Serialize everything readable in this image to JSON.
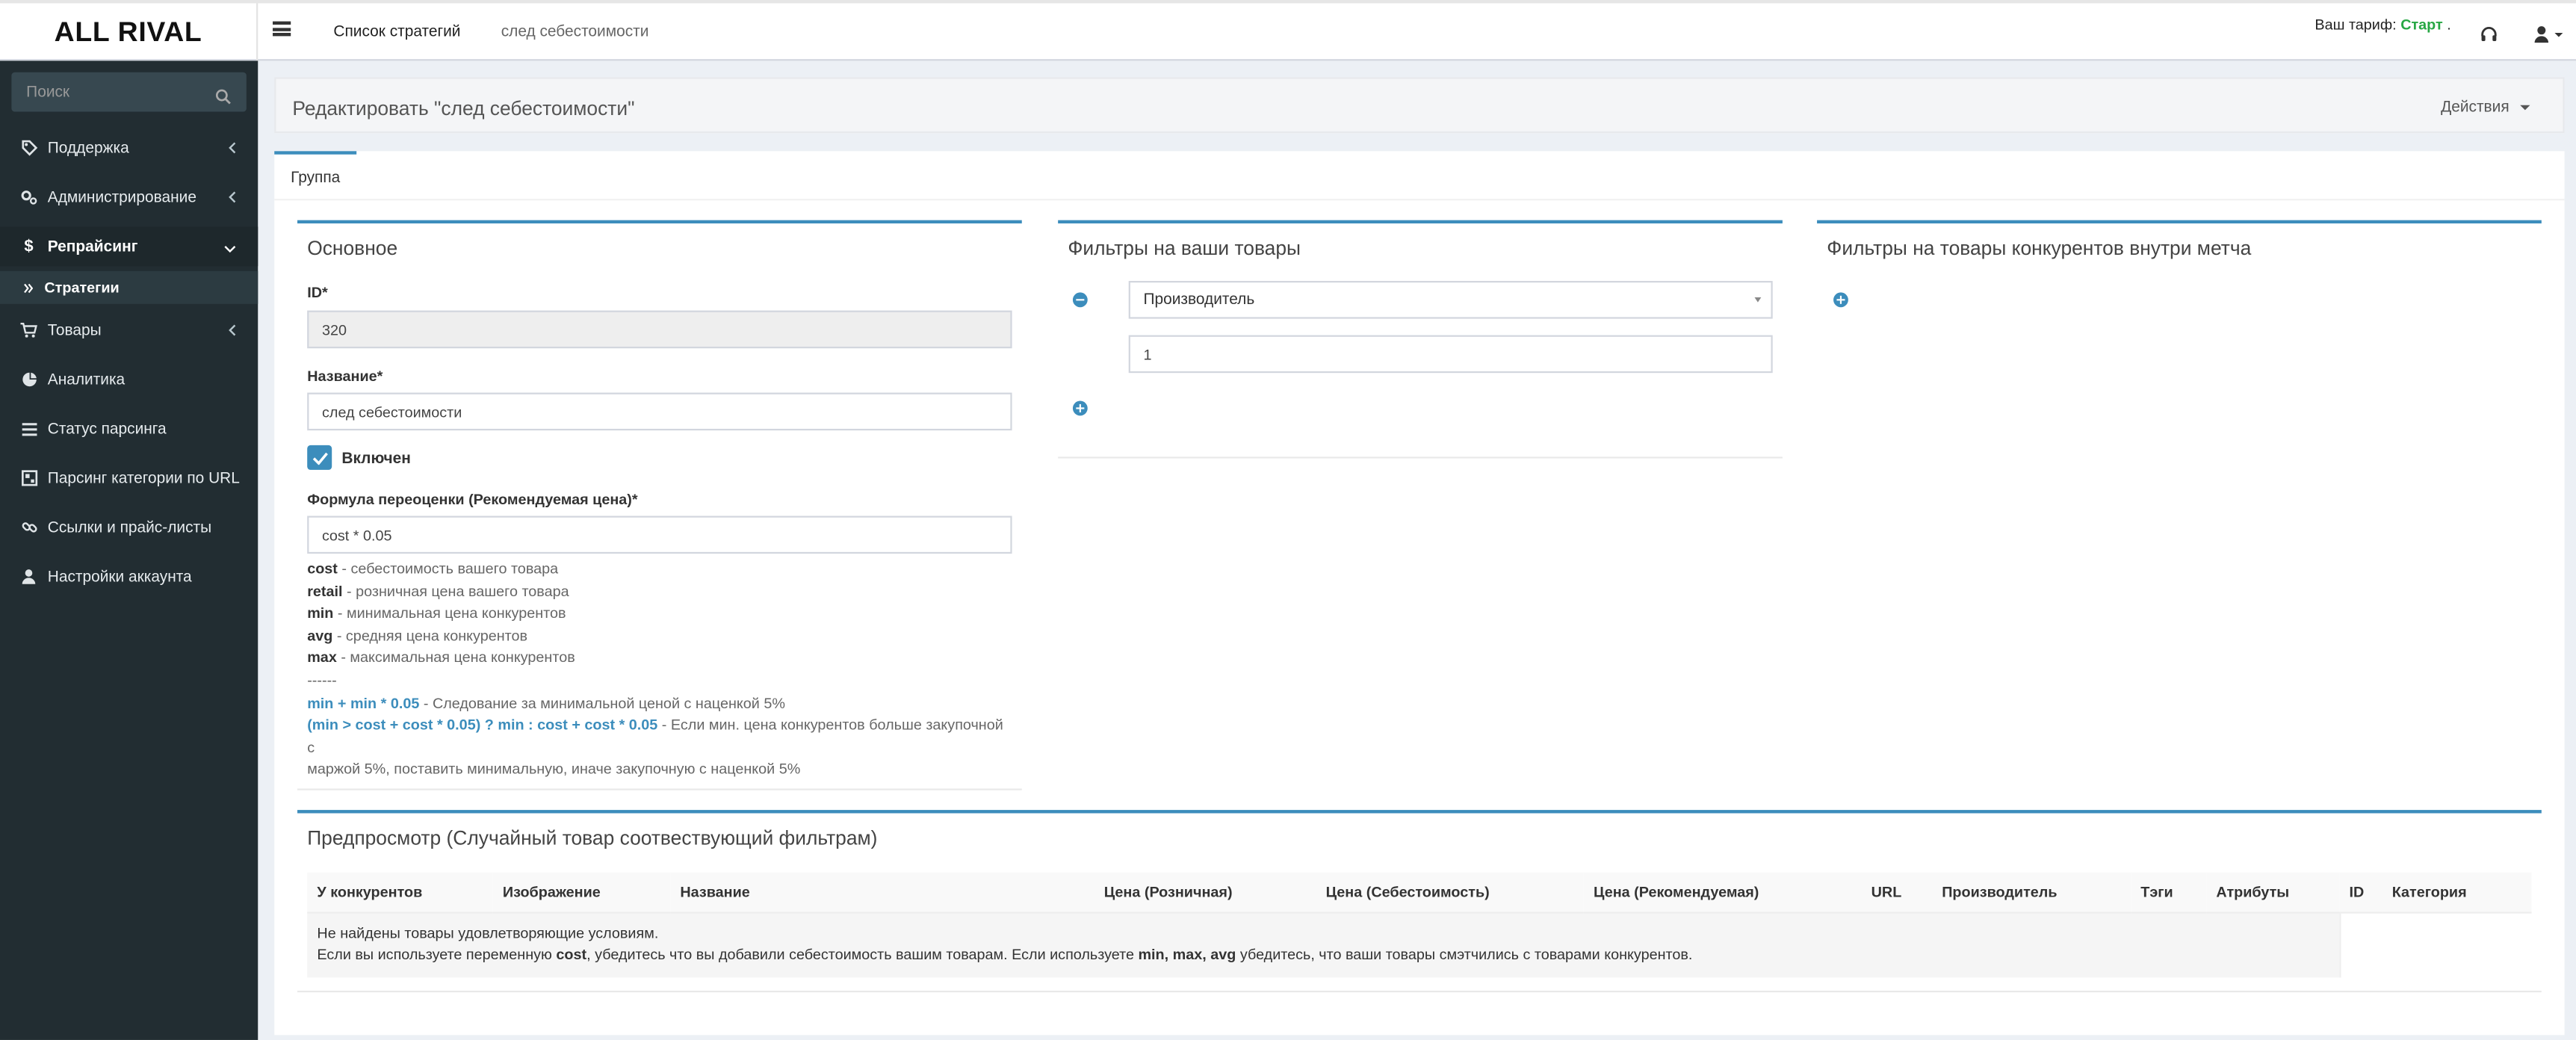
{
  "header": {
    "logo": "ALL RIVAL",
    "nav": [
      "Список стратегий",
      "след себестоимости"
    ],
    "tariff_prefix": "Ваш тариф:",
    "tariff_plan": "Старт",
    "tariff_suffix": ".",
    "icons": [
      "headset-icon",
      "user-icon"
    ]
  },
  "sidebar": {
    "search_placeholder": "Поиск",
    "items": [
      {
        "label": "Поддержка",
        "icon": "tag-icon",
        "chevron": "left"
      },
      {
        "label": "Администрирование",
        "icon": "cogs-icon",
        "chevron": "left"
      },
      {
        "label": "Репрайсинг",
        "icon": "dollar-icon",
        "chevron": "down",
        "active": true
      },
      {
        "label": "Товары",
        "icon": "cart-icon",
        "chevron": "left"
      },
      {
        "label": "Аналитика",
        "icon": "pie-chart-icon"
      },
      {
        "label": "Статус парсинга",
        "icon": "list-icon"
      },
      {
        "label": "Парсинг категории по URL",
        "icon": "table-icon"
      },
      {
        "label": "Ссылки и прайс-листы",
        "icon": "link-icon"
      },
      {
        "label": "Настройки аккаунта",
        "icon": "user-icon"
      }
    ],
    "sub_item": "Стратегии"
  },
  "page": {
    "title": "Редактировать \"след себестоимости\"",
    "actions_label": "Действия",
    "tab": "Группа"
  },
  "main_box": {
    "title": "Основное",
    "id_label": "ID*",
    "id_value": "320",
    "name_label": "Название*",
    "name_value": "след себестоимости",
    "enabled_label": "Включен",
    "enabled": true,
    "formula_label": "Формула переоценки (Рекомендуемая цена)*",
    "formula_value": "cost * 0.05",
    "help": [
      {
        "term": "cost",
        "desc": " - себестоимость вашего товара"
      },
      {
        "term": "retail",
        "desc": " - розничная цена вашего товара"
      },
      {
        "term": "min",
        "desc": " - минимальная цена конкурентов"
      },
      {
        "term": "avg",
        "desc": " - средняя цена конкурентов"
      },
      {
        "term": "max",
        "desc": " - максимальная цена конкурентов"
      }
    ],
    "separator": "------",
    "example1_code": "min + min * 0.05",
    "example1_desc": " - Следование за минимальной ценой с наценкой 5%",
    "example2_code": "(min > cost + cost * 0.05) ? min : cost + cost * 0.05",
    "example2_desc": " - Если мин. цена конкурентов больше закупочной с",
    "example2_desc2": "маржой 5%, поставить минимальную, иначе закупочную с наценкой 5%"
  },
  "filters_box": {
    "title": "Фильтры на ваши товары",
    "select_value": "Производитель",
    "input_value": "1"
  },
  "competitor_box": {
    "title": "Фильтры на товары конкурентов внутри метча"
  },
  "preview": {
    "title": "Предпросмотр (Случайный товар соотвествующий фильтрам)",
    "columns": [
      "У конкурентов",
      "Изображение",
      "Название",
      "Цена (Розничная)",
      "Цена (Себестоимость)",
      "Цена (Рекомендуемая)",
      "URL",
      "Производитель",
      "Тэги",
      "Атрибуты",
      "ID",
      "Категория"
    ],
    "empty_line1": "Не найдены товары удовлетворяющие условиям.",
    "empty_line2_a": "Если вы используете переменную ",
    "empty_line2_b": "cost",
    "empty_line2_c": ", убедитесь что вы добавили себестоимость вашим товарам. Если используете ",
    "empty_line2_d": "min, max, avg",
    "empty_line2_e": " убедитесь, что ваши товары смэтчились с товарами конкурентов."
  },
  "colors": {
    "accent": "#3c8dbc",
    "sidebar_bg": "#222d32",
    "tariff_plan": "#27a744"
  }
}
